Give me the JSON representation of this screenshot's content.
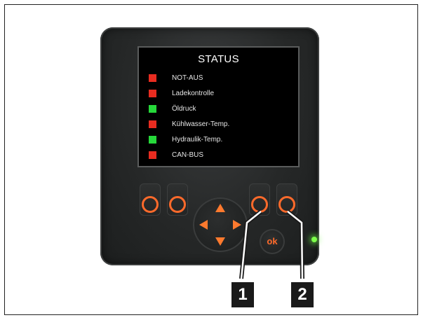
{
  "screen": {
    "title": "STATUS",
    "items": [
      {
        "label": "NOT-AUS",
        "color": "#e82c20"
      },
      {
        "label": "Ladekontrolle",
        "color": "#e82c20"
      },
      {
        "label": "Öldruck",
        "color": "#26d83a"
      },
      {
        "label": "Kühlwasser-Temp.",
        "color": "#e82c20"
      },
      {
        "label": "Hydraulik-Temp.",
        "color": "#26d83a"
      },
      {
        "label": "CAN-BUS",
        "color": "#e82c20"
      }
    ]
  },
  "buttons": {
    "ok_label": "ok"
  },
  "callouts": {
    "one": "1",
    "two": "2"
  },
  "colors": {
    "accent": "#ff6a2b",
    "status_red": "#e82c20",
    "status_green": "#26d83a",
    "power_led": "#7dff4a"
  }
}
